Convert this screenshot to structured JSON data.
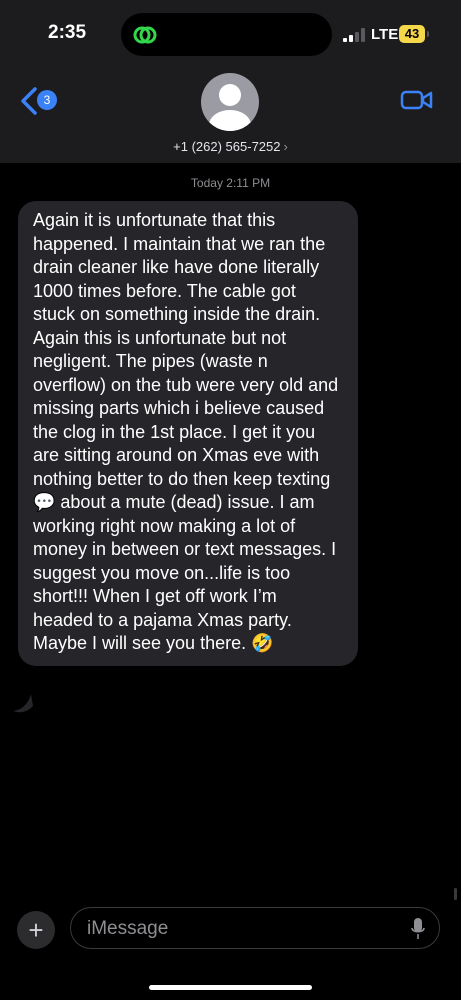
{
  "status_bar": {
    "time": "2:35",
    "network": "LTE",
    "battery": "43"
  },
  "nav": {
    "back_count": "3",
    "contact": "+1 (262) 565-7252",
    "chevron": "›"
  },
  "thread": {
    "timestamp": "Today 2:11 PM",
    "message": "Again it is unfortunate that this happened. I maintain that we ran the drain cleaner like have done literally 1000 times before. The cable got stuck on something inside the drain.  Again this is unfortunate but not negligent. The pipes (waste n overflow) on the tub were very old and missing parts which i believe caused the clog in the 1st place. I get it you are sitting around on Xmas eve with nothing better to do then keep texting 💬 about a mute (dead) issue. I am working right now making a lot of money in between or text messages. I suggest you move on...life is too short!!! When I get off work I’m headed to a pajama Xmas party. Maybe I will see you there. 🤣"
  },
  "composer": {
    "plus": "+",
    "placeholder": "iMessage"
  },
  "colors": {
    "accent": "#3b82f6",
    "bubble": "#26252a",
    "battery": "#f5d84a"
  },
  "icons": [
    "back-chevron-icon",
    "person-icon",
    "video-camera-icon",
    "microphone-icon",
    "signal-icon",
    "activity-icon"
  ]
}
